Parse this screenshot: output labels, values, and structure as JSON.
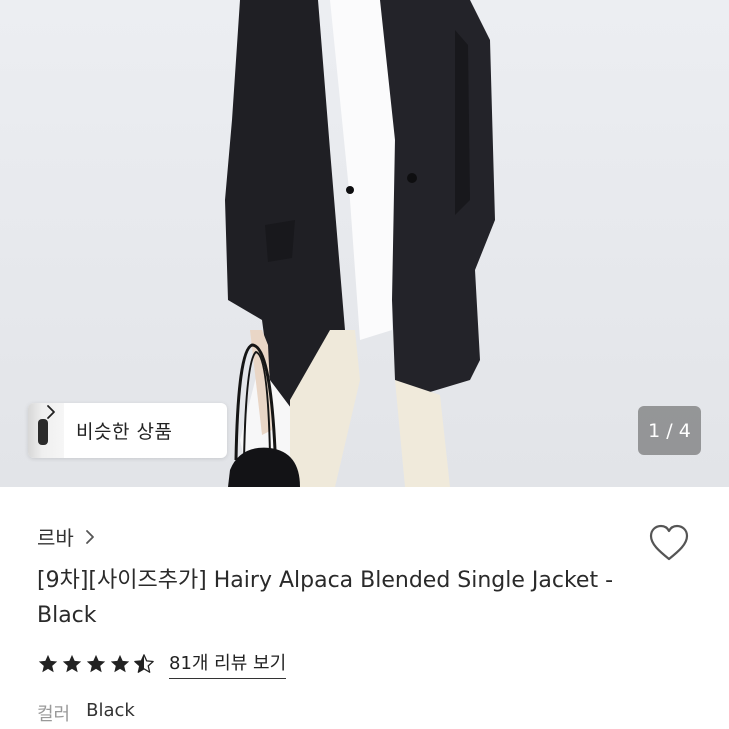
{
  "gallery": {
    "similar_label": "비슷한 상품",
    "counter": "1 / 4",
    "icons": [
      "similar-thumb",
      "chevron-right-icon"
    ]
  },
  "product": {
    "seller": "르바",
    "title": "[9차][사이즈추가] Hairy Alpaca Blended Single Jacket - Black",
    "rating": 4.5,
    "review_link": "81개 리뷰 보기",
    "option_label": "컬러",
    "option_value": "Black"
  },
  "icons": {
    "wishlist": "heart-outline-icon",
    "seller_nav": "chevron-right-icon",
    "rating": "star-icon"
  }
}
